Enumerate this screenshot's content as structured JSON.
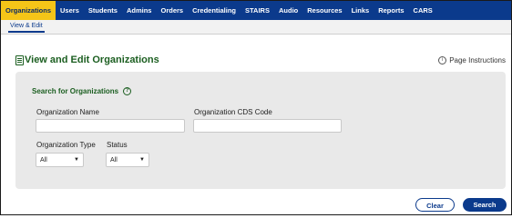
{
  "nav": {
    "items": [
      "Organizations",
      "Users",
      "Students",
      "Admins",
      "Orders",
      "Credentialing",
      "STAIRS",
      "Audio",
      "Resources",
      "Links",
      "Reports",
      "CARS"
    ]
  },
  "subnav": {
    "tab": "View & Edit"
  },
  "header": {
    "title": "View and Edit Organizations",
    "instructions": "Page Instructions"
  },
  "search": {
    "title": "Search for Organizations",
    "org_name_label": "Organization Name",
    "org_cds_label": "Organization CDS Code",
    "org_type_label": "Organization Type",
    "status_label": "Status",
    "org_type_value": "All",
    "status_value": "All"
  },
  "buttons": {
    "clear": "Clear",
    "search": "Search"
  },
  "colors": {
    "nav_bg": "#0b3a8c",
    "nav_active": "#f5c518",
    "heading_green": "#1b5e20"
  }
}
